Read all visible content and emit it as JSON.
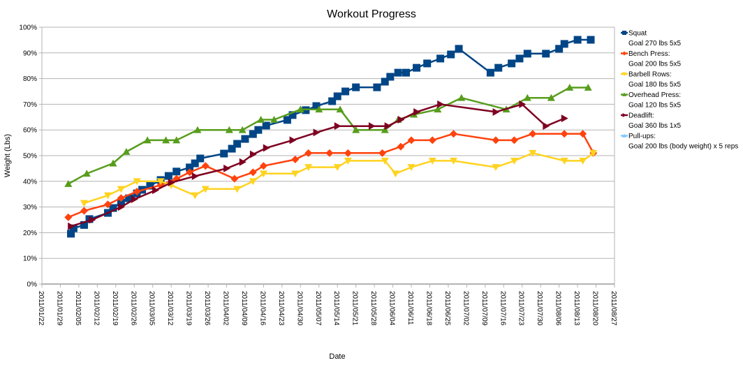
{
  "chart_data": {
    "type": "line",
    "title": "Workout Progress",
    "xlabel": "Date",
    "ylabel": "Weight (Lbs)",
    "ylim": [
      0,
      100
    ],
    "y_ticks": [
      "0%",
      "10%",
      "20%",
      "30%",
      "40%",
      "50%",
      "60%",
      "70%",
      "80%",
      "90%",
      "100%"
    ],
    "x_range": [
      "2011/01/22",
      "2011/08/27"
    ],
    "x_ticks": [
      "2011/01/22",
      "2011/01/29",
      "2011/02/05",
      "2011/02/12",
      "2011/02/19",
      "2011/02/26",
      "2011/03/05",
      "2011/03/12",
      "2011/03/19",
      "2011/03/26",
      "2011/04/02",
      "2011/04/09",
      "2011/04/16",
      "2011/04/23",
      "2011/04/30",
      "2011/05/07",
      "2011/05/14",
      "2011/05/21",
      "2011/05/28",
      "2011/06/04",
      "2011/06/11",
      "2011/06/18",
      "2011/06/25",
      "2011/07/02",
      "2011/07/09",
      "2011/07/16",
      "2011/07/23",
      "2011/07/30",
      "2011/08/06",
      "2011/08/13",
      "2011/08/20",
      "2011/08/27"
    ],
    "grid": true,
    "legend_position": "right",
    "series": [
      {
        "name": "Squat",
        "goal": "Goal 270 lbs 5x5",
        "color": "#004586",
        "marker": "square",
        "points": [
          [
            "2011/02/02",
            19.6
          ],
          [
            "2011/02/03",
            21.7
          ],
          [
            "2011/02/07",
            23
          ],
          [
            "2011/02/09",
            25.3
          ],
          [
            "2011/02/16",
            27.7
          ],
          [
            "2011/02/18",
            29.6
          ],
          [
            "2011/02/21",
            31.8
          ],
          [
            "2011/02/24",
            33.4
          ],
          [
            "2011/02/27",
            35.3
          ],
          [
            "2011/03/01",
            36.7
          ],
          [
            "2011/03/04",
            38.3
          ],
          [
            "2011/03/08",
            40.5
          ],
          [
            "2011/03/11",
            42.1
          ],
          [
            "2011/03/14",
            43.8
          ],
          [
            "2011/03/19",
            45.4
          ],
          [
            "2011/03/21",
            47
          ],
          [
            "2011/03/23",
            48.9
          ],
          [
            "2011/04/01",
            50.8
          ],
          [
            "2011/04/04",
            52.7
          ],
          [
            "2011/04/06",
            54.6
          ],
          [
            "2011/04/09",
            56.5
          ],
          [
            "2011/04/12",
            58.4
          ],
          [
            "2011/04/14",
            60
          ],
          [
            "2011/04/17",
            61.7
          ],
          [
            "2011/04/25",
            63.9
          ],
          [
            "2011/04/27",
            65.8
          ],
          [
            "2011/05/02",
            67.7
          ],
          [
            "2011/05/06",
            69.3
          ],
          [
            "2011/05/12",
            71.2
          ],
          [
            "2011/05/14",
            73.1
          ],
          [
            "2011/05/17",
            75
          ],
          [
            "2011/05/21",
            76.6
          ],
          [
            "2011/05/29",
            76.6
          ],
          [
            "2011/06/01",
            78.8
          ],
          [
            "2011/06/03",
            80.7
          ],
          [
            "2011/06/06",
            82.3
          ],
          [
            "2011/06/09",
            82.3
          ],
          [
            "2011/06/13",
            84.2
          ],
          [
            "2011/06/17",
            85.9
          ],
          [
            "2011/06/22",
            87.8
          ],
          [
            "2011/06/26",
            89.4
          ],
          [
            "2011/06/29",
            91.6
          ],
          [
            "2011/07/11",
            82.3
          ],
          [
            "2011/07/14",
            84.2
          ],
          [
            "2011/07/19",
            85.9
          ],
          [
            "2011/07/22",
            87.8
          ],
          [
            "2011/07/25",
            89.7
          ],
          [
            "2011/08/01",
            89.7
          ],
          [
            "2011/08/06",
            91.6
          ],
          [
            "2011/08/08",
            93.5
          ],
          [
            "2011/08/13",
            95.1
          ],
          [
            "2011/08/18",
            95.1
          ]
        ]
      },
      {
        "name": "Bench Press:",
        "goal": "Goal 200 lbs 5x5",
        "color": "#ff420e",
        "marker": "diamond",
        "points": [
          [
            "2011/02/01",
            26
          ],
          [
            "2011/02/07",
            28.5
          ],
          [
            "2011/02/16",
            31
          ],
          [
            "2011/02/21",
            33.5
          ],
          [
            "2011/02/27",
            36
          ],
          [
            "2011/03/08",
            38.5
          ],
          [
            "2011/03/14",
            41
          ],
          [
            "2011/03/19",
            43.5
          ],
          [
            "2011/03/25",
            46
          ],
          [
            "2011/04/05",
            41
          ],
          [
            "2011/04/12",
            43.5
          ],
          [
            "2011/04/16",
            46
          ],
          [
            "2011/04/28",
            48.5
          ],
          [
            "2011/05/03",
            51
          ],
          [
            "2011/05/11",
            51
          ],
          [
            "2011/05/18",
            51
          ],
          [
            "2011/05/31",
            51
          ],
          [
            "2011/06/07",
            53.5
          ],
          [
            "2011/06/11",
            56
          ],
          [
            "2011/06/19",
            56
          ],
          [
            "2011/06/27",
            58.5
          ],
          [
            "2011/07/13",
            56
          ],
          [
            "2011/07/20",
            56
          ],
          [
            "2011/07/27",
            58.5
          ],
          [
            "2011/08/08",
            58.5
          ],
          [
            "2011/08/15",
            58.5
          ],
          [
            "2011/08/19",
            51
          ]
        ]
      },
      {
        "name": "Barbell Rows:",
        "goal": "Goal 180 lbs 5x5",
        "color": "#ffd320",
        "marker": "triangle-down",
        "points": [
          [
            "2011/02/07",
            31.5
          ],
          [
            "2011/02/16",
            34.5
          ],
          [
            "2011/02/21",
            37
          ],
          [
            "2011/02/27",
            40
          ],
          [
            "2011/03/08",
            40
          ],
          [
            "2011/03/12",
            38.5
          ],
          [
            "2011/03/21",
            34.5
          ],
          [
            "2011/03/25",
            37
          ],
          [
            "2011/04/06",
            37
          ],
          [
            "2011/04/12",
            40
          ],
          [
            "2011/04/16",
            43
          ],
          [
            "2011/04/28",
            43
          ],
          [
            "2011/05/03",
            45.5
          ],
          [
            "2011/05/14",
            45.5
          ],
          [
            "2011/05/18",
            48
          ],
          [
            "2011/06/01",
            48
          ],
          [
            "2011/06/05",
            43
          ],
          [
            "2011/06/11",
            45.5
          ],
          [
            "2011/06/19",
            48
          ],
          [
            "2011/06/27",
            48
          ],
          [
            "2011/07/13",
            45.5
          ],
          [
            "2011/07/20",
            48
          ],
          [
            "2011/07/27",
            51
          ],
          [
            "2011/08/08",
            48
          ],
          [
            "2011/08/15",
            48
          ],
          [
            "2011/08/19",
            51
          ]
        ]
      },
      {
        "name": "Overhead Press:",
        "goal": "Goal 120 lbs 5x5",
        "color": "#579d1c",
        "marker": "triangle-up",
        "points": [
          [
            "2011/02/01",
            39
          ],
          [
            "2011/02/08",
            43
          ],
          [
            "2011/02/18",
            47
          ],
          [
            "2011/02/23",
            51.5
          ],
          [
            "2011/03/03",
            56
          ],
          [
            "2011/03/10",
            56
          ],
          [
            "2011/03/14",
            56
          ],
          [
            "2011/03/22",
            60
          ],
          [
            "2011/04/03",
            60
          ],
          [
            "2011/04/08",
            60
          ],
          [
            "2011/04/15",
            64
          ],
          [
            "2011/04/20",
            64
          ],
          [
            "2011/04/30",
            68
          ],
          [
            "2011/05/07",
            68
          ],
          [
            "2011/05/15",
            68
          ],
          [
            "2011/05/21",
            60
          ],
          [
            "2011/06/01",
            60
          ],
          [
            "2011/06/06",
            64
          ],
          [
            "2011/06/12",
            66
          ],
          [
            "2011/06/21",
            68
          ],
          [
            "2011/06/30",
            72.5
          ],
          [
            "2011/07/17",
            68
          ],
          [
            "2011/07/25",
            72.5
          ],
          [
            "2011/08/03",
            72.5
          ],
          [
            "2011/08/10",
            76.5
          ],
          [
            "2011/08/17",
            76.5
          ]
        ]
      },
      {
        "name": "Deadlift:",
        "goal": "Goal 360 lbs 1x5",
        "color": "#7e0021",
        "marker": "triangle-right",
        "points": [
          [
            "2011/02/02",
            22.5
          ],
          [
            "2011/02/10",
            25
          ],
          [
            "2011/02/21",
            30
          ],
          [
            "2011/02/26",
            33
          ],
          [
            "2011/03/06",
            36.5
          ],
          [
            "2011/03/12",
            39.5
          ],
          [
            "2011/03/21",
            42
          ],
          [
            "2011/04/02",
            45
          ],
          [
            "2011/04/08",
            47.5
          ],
          [
            "2011/04/12",
            50.5
          ],
          [
            "2011/04/17",
            53
          ],
          [
            "2011/04/27",
            56
          ],
          [
            "2011/05/06",
            59
          ],
          [
            "2011/05/14",
            61.5
          ],
          [
            "2011/05/27",
            61.5
          ],
          [
            "2011/06/02",
            61.5
          ],
          [
            "2011/06/07",
            64
          ],
          [
            "2011/06/13",
            67
          ],
          [
            "2011/06/22",
            70
          ],
          [
            "2011/07/13",
            67
          ],
          [
            "2011/07/23",
            70
          ],
          [
            "2011/08/01",
            61.5
          ],
          [
            "2011/08/08",
            64.5
          ]
        ]
      },
      {
        "name": "Pull-ups:",
        "goal": "Goal 200 lbs (body weight) x 5 reps",
        "color": "#83caff",
        "marker": "none",
        "points": []
      }
    ]
  }
}
